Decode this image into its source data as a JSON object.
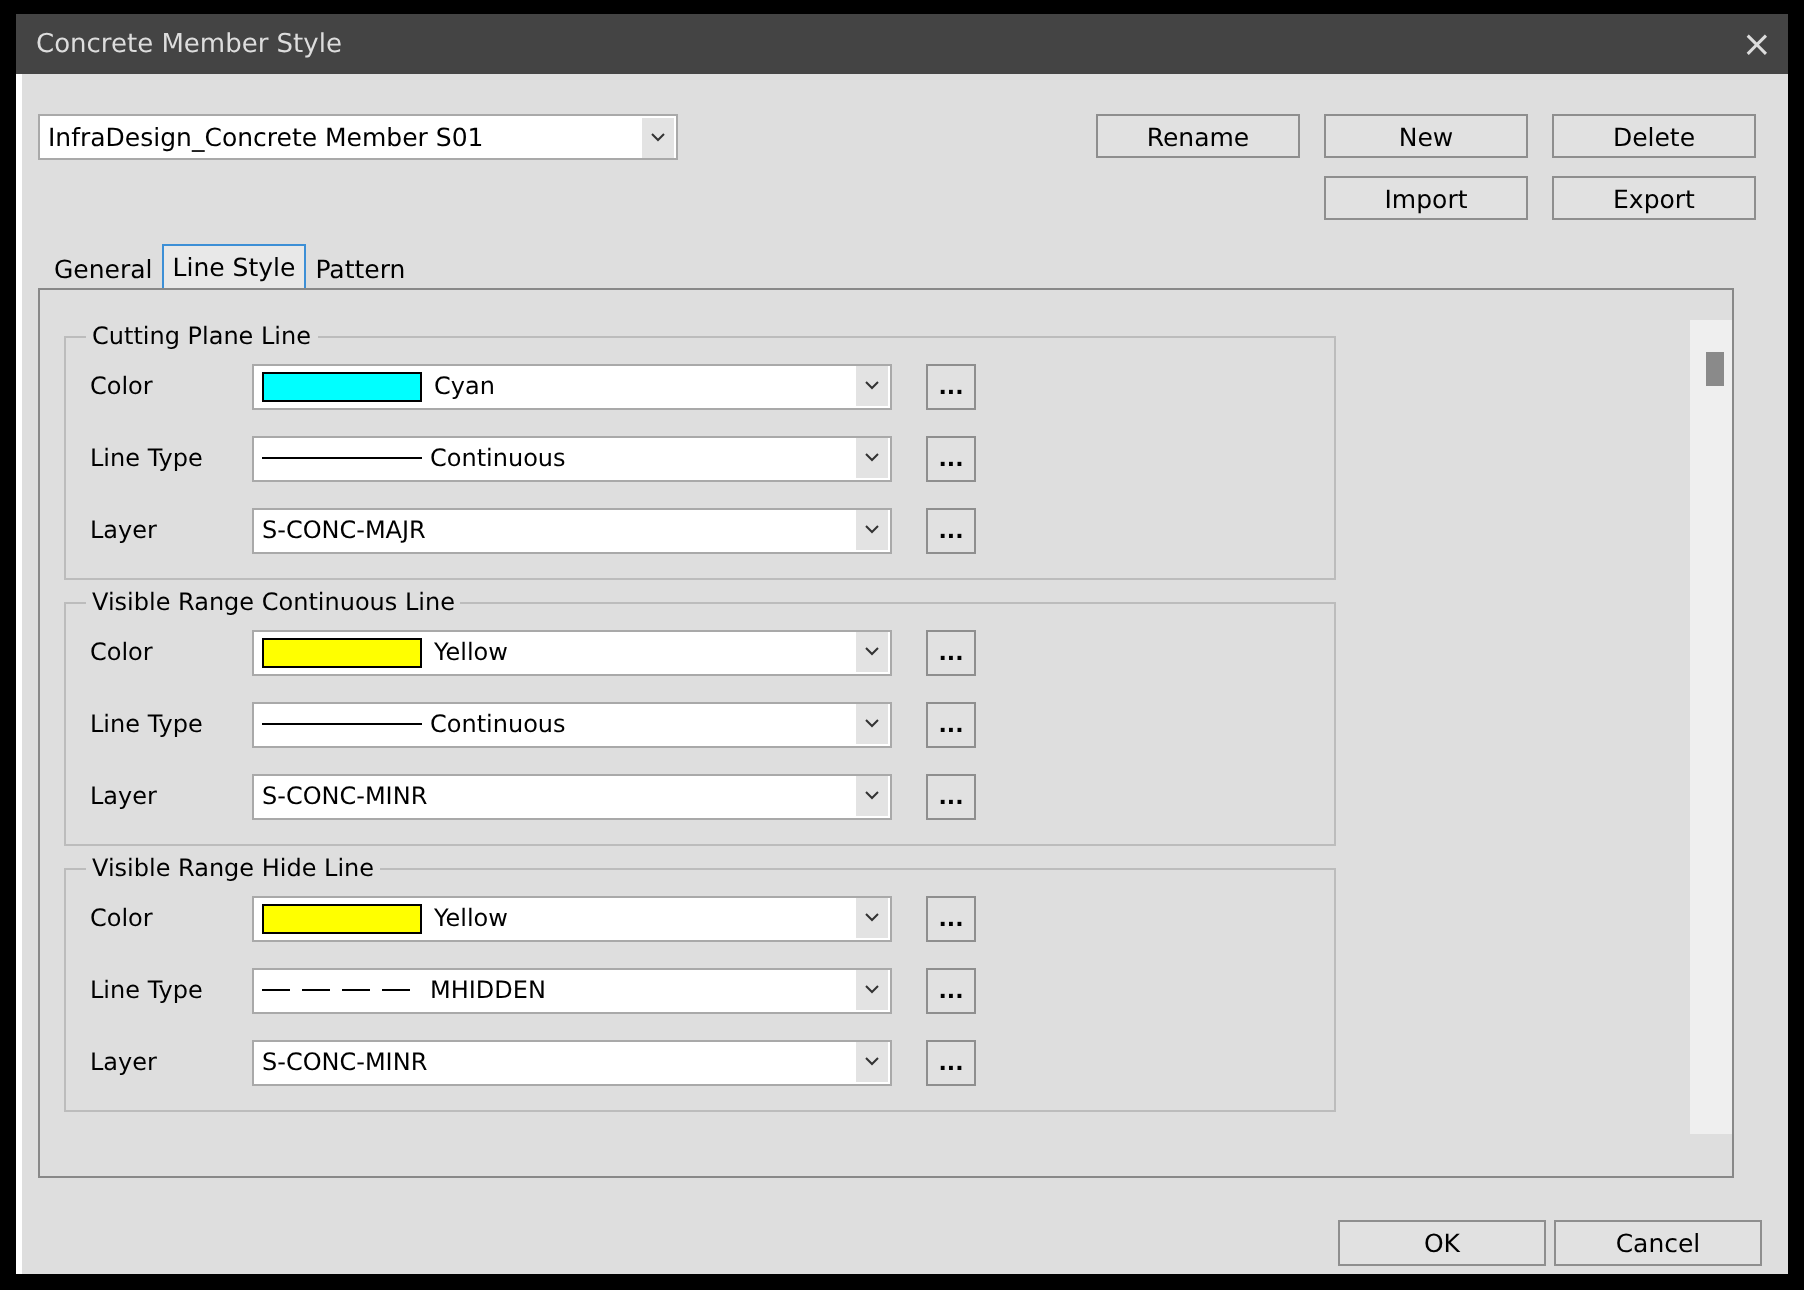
{
  "window": {
    "title": "Concrete Member Style",
    "close": "×"
  },
  "style_select": {
    "value": "InfraDesign_Concrete Member S01"
  },
  "top_buttons": [
    {
      "label": "Rename"
    },
    {
      "label": "New"
    },
    {
      "label": "Delete"
    },
    {
      "label": "Import"
    },
    {
      "label": "Export"
    }
  ],
  "tabs": [
    {
      "label": "General",
      "selected": false
    },
    {
      "label": "Line Style",
      "selected": true
    },
    {
      "label": "Pattern",
      "selected": false
    }
  ],
  "groups": [
    {
      "title": "Cutting Plane Line",
      "rows": [
        {
          "kind": "color",
          "label": "Color",
          "value": "Cyan",
          "color": "#00ffff",
          "more": "..."
        },
        {
          "kind": "linetype",
          "label": "Line Type",
          "value": "Continuous",
          "sample": {
            "kind": "solid"
          },
          "more": "..."
        },
        {
          "kind": "layer",
          "label": "Layer",
          "value": "S-CONC-MAJR",
          "more": "..."
        }
      ]
    },
    {
      "title": "Visible Range Continuous Line",
      "rows": [
        {
          "kind": "color",
          "label": "Color",
          "value": "Yellow",
          "color": "#ffff00",
          "more": "..."
        },
        {
          "kind": "linetype",
          "label": "Line Type",
          "value": "Continuous",
          "sample": {
            "kind": "solid"
          },
          "more": "..."
        },
        {
          "kind": "layer",
          "label": "Layer",
          "value": "S-CONC-MINR",
          "more": "..."
        }
      ]
    },
    {
      "title": "Visible Range Hide Line",
      "rows": [
        {
          "kind": "color",
          "label": "Color",
          "value": "Yellow",
          "color": "#ffff00",
          "more": "..."
        },
        {
          "kind": "linetype",
          "label": "Line Type",
          "value": "MHIDDEN",
          "sample": {
            "kind": "dashed"
          },
          "more": "..."
        },
        {
          "kind": "layer",
          "label": "Layer",
          "value": "S-CONC-MINR",
          "more": "..."
        }
      ]
    }
  ],
  "footer_buttons": [
    {
      "label": "OK"
    },
    {
      "label": "Cancel"
    }
  ]
}
